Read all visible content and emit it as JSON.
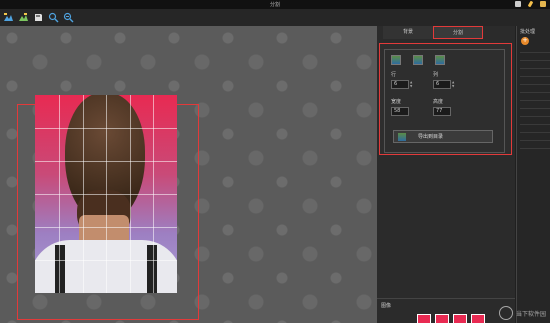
{
  "window": {
    "title": "分割"
  },
  "toolbar": {
    "tools": [
      {
        "name": "open-image-icon"
      },
      {
        "name": "recent-image-icon"
      },
      {
        "name": "save-icon"
      },
      {
        "name": "zoom-in-icon"
      },
      {
        "name": "zoom-out-icon"
      }
    ]
  },
  "sidebar": {
    "tabs": [
      {
        "label": "背景"
      },
      {
        "label": "分割",
        "active": true
      }
    ],
    "split_panel": {
      "rows_label": "行",
      "rows_value": "6",
      "cols_label": "列",
      "cols_value": "6",
      "width_label": "宽度",
      "width_value": "58",
      "height_label": "高度",
      "height_value": "77",
      "export_label": "导出到目录"
    },
    "image_strip": {
      "label": "图像"
    }
  },
  "right_panel": {
    "title": "批处理"
  },
  "colors": {
    "highlight": "#e23a3a",
    "canvas_bg": "#5b5b5b",
    "accent": "#e88a2a"
  },
  "watermark": {
    "text": "当下软件园"
  }
}
